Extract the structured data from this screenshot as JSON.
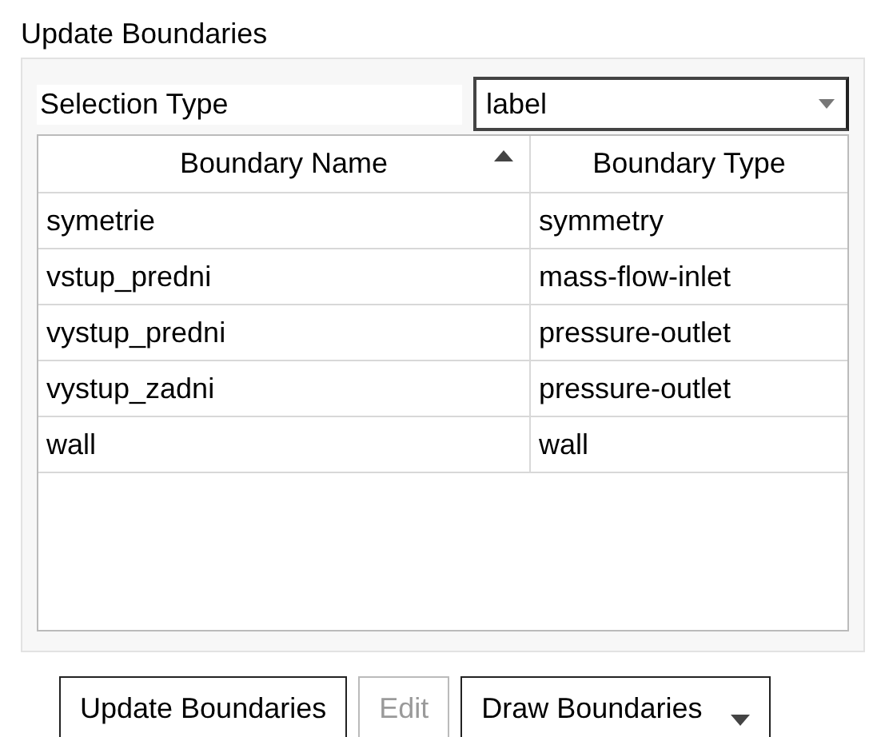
{
  "title": "Update Boundaries",
  "selection_type": {
    "label": "Selection Type",
    "value": "label"
  },
  "table": {
    "columns": [
      {
        "label": "Boundary Name",
        "sorted": true
      },
      {
        "label": "Boundary Type",
        "sorted": false
      }
    ],
    "rows": [
      {
        "name": "symetrie",
        "type": "symmetry"
      },
      {
        "name": "vstup_predni",
        "type": "mass-flow-inlet"
      },
      {
        "name": "vystup_predni",
        "type": "pressure-outlet"
      },
      {
        "name": "vystup_zadni",
        "type": "pressure-outlet"
      },
      {
        "name": "wall",
        "type": "wall"
      }
    ]
  },
  "buttons": [
    {
      "label": "Update Boundaries",
      "disabled": false,
      "kind": "plain"
    },
    {
      "label": "Edit",
      "disabled": true,
      "kind": "plain"
    },
    {
      "label": "Draw Boundaries",
      "disabled": false,
      "kind": "menu"
    }
  ]
}
